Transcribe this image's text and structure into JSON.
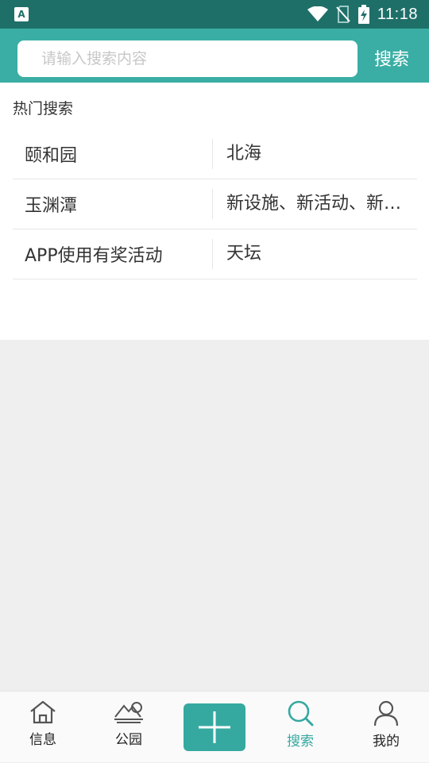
{
  "status_bar": {
    "time": "11:18",
    "icons": [
      "app-a-icon",
      "wifi-icon",
      "no-sim-icon",
      "battery-charging-icon"
    ]
  },
  "search": {
    "placeholder": "请输入搜索内容",
    "button_label": "搜索"
  },
  "hot_search": {
    "title": "热门搜索",
    "rows": [
      [
        "颐和园",
        "北海"
      ],
      [
        "玉渊潭",
        "新设施、新活动、新体验"
      ],
      [
        "APP使用有奖活动",
        "天坛"
      ]
    ]
  },
  "tabbar": {
    "tabs": [
      {
        "label": "信息",
        "icon": "home-icon"
      },
      {
        "label": "公园",
        "icon": "mountain-icon"
      },
      {
        "label": "",
        "icon": "plus-icon"
      },
      {
        "label": "搜索",
        "icon": "search-icon"
      },
      {
        "label": "我的",
        "icon": "user-icon"
      }
    ],
    "active_index": 3,
    "accent_color": "#35a9a0"
  },
  "colors": {
    "status_bar": "#1f6f69",
    "header": "#3aaea5",
    "background": "#efefef"
  }
}
